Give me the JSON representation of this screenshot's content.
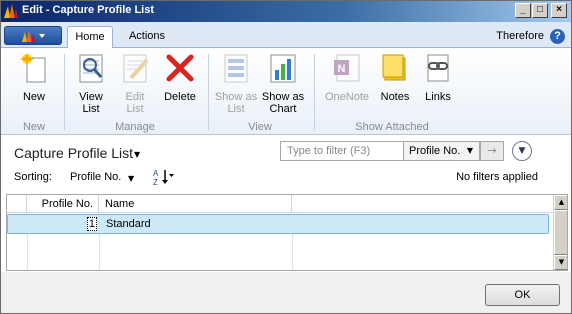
{
  "window": {
    "title": "Edit - Capture Profile List",
    "controls": {
      "minimize": "_",
      "maximize": "□",
      "close": "×"
    }
  },
  "ribbon": {
    "tabs": [
      {
        "label": "Home"
      },
      {
        "label": "Actions"
      }
    ],
    "right_label": "Therefore",
    "help_glyph": "?",
    "buttons": {
      "new": "New",
      "view_list": "View List",
      "edit_list": "Edit List",
      "delete": "Delete",
      "show_as_list": "Show as List",
      "show_as_chart": "Show as Chart",
      "onenote": "OneNote",
      "notes": "Notes",
      "links": "Links"
    },
    "groups": {
      "new": "New",
      "manage": "Manage",
      "view": "View",
      "show_attached": "Show Attached"
    }
  },
  "list": {
    "title": "Capture Profile List",
    "filter_placeholder": "Type to filter (F3)",
    "filter_field": "Profile No.",
    "sorting_label": "Sorting:",
    "sort_field": "Profile No.",
    "filter_status": "No filters applied",
    "columns": [
      "Profile No.",
      "Name"
    ],
    "rows": [
      {
        "profile_no": "1",
        "name": "Standard"
      }
    ]
  },
  "footer": {
    "ok_label": "OK"
  },
  "colors": {
    "title_bar": "#0a246a",
    "selected_row": "#cde8f6",
    "ribbon_bg": "#dfe9f5"
  },
  "icons": [
    "app-logo-icon",
    "new-icon",
    "view-list-icon",
    "edit-list-icon",
    "delete-icon",
    "show-as-list-icon",
    "show-as-chart-icon",
    "onenote-icon",
    "notes-icon",
    "links-icon",
    "expand-icon",
    "sort-direction-icon"
  ]
}
